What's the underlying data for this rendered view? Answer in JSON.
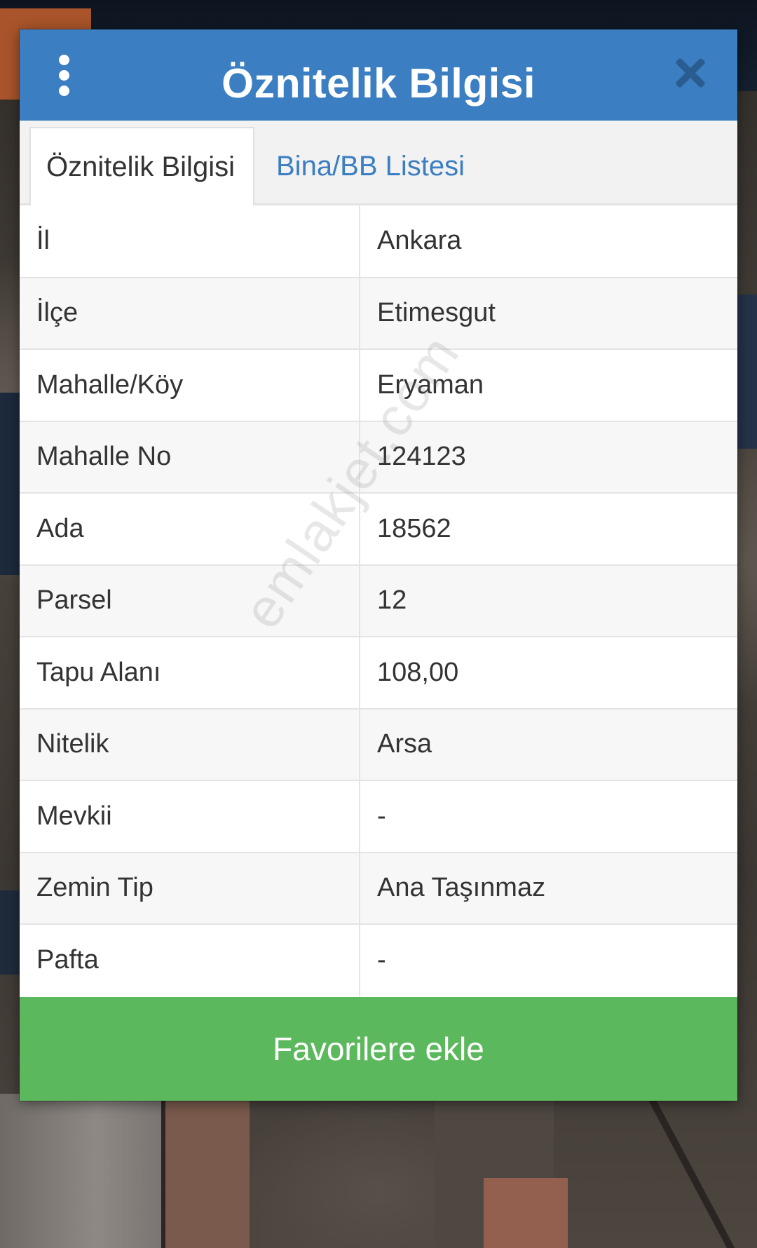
{
  "dialog": {
    "title": "Öznitelik Bilgisi",
    "menu_icon": "kebab-menu-icon",
    "close_icon": "close-icon"
  },
  "tabs": [
    {
      "label": "Öznitelik Bilgisi",
      "active": true
    },
    {
      "label": "Bina/BB Listesi",
      "active": false
    }
  ],
  "attributes": [
    {
      "key": "İl",
      "value": "Ankara"
    },
    {
      "key": "İlçe",
      "value": "Etimesgut"
    },
    {
      "key": "Mahalle/Köy",
      "value": "Eryaman"
    },
    {
      "key": "Mahalle No",
      "value": "124123"
    },
    {
      "key": "Ada",
      "value": "18562"
    },
    {
      "key": "Parsel",
      "value": "12"
    },
    {
      "key": "Tapu Alanı",
      "value": "108,00"
    },
    {
      "key": "Nitelik",
      "value": "Arsa"
    },
    {
      "key": "Mevkii",
      "value": "-"
    },
    {
      "key": "Zemin Tip",
      "value": "Ana Taşınmaz"
    },
    {
      "key": "Pafta",
      "value": "-"
    }
  ],
  "footer": {
    "button_label": "Favorilere ekle"
  },
  "watermark": "emlakjet.com",
  "colors": {
    "header": "#3b7ec2",
    "close_icon": "#2a5c8f",
    "tab_link": "#3b7ec2",
    "button": "#5cb85c",
    "text": "#333333"
  }
}
